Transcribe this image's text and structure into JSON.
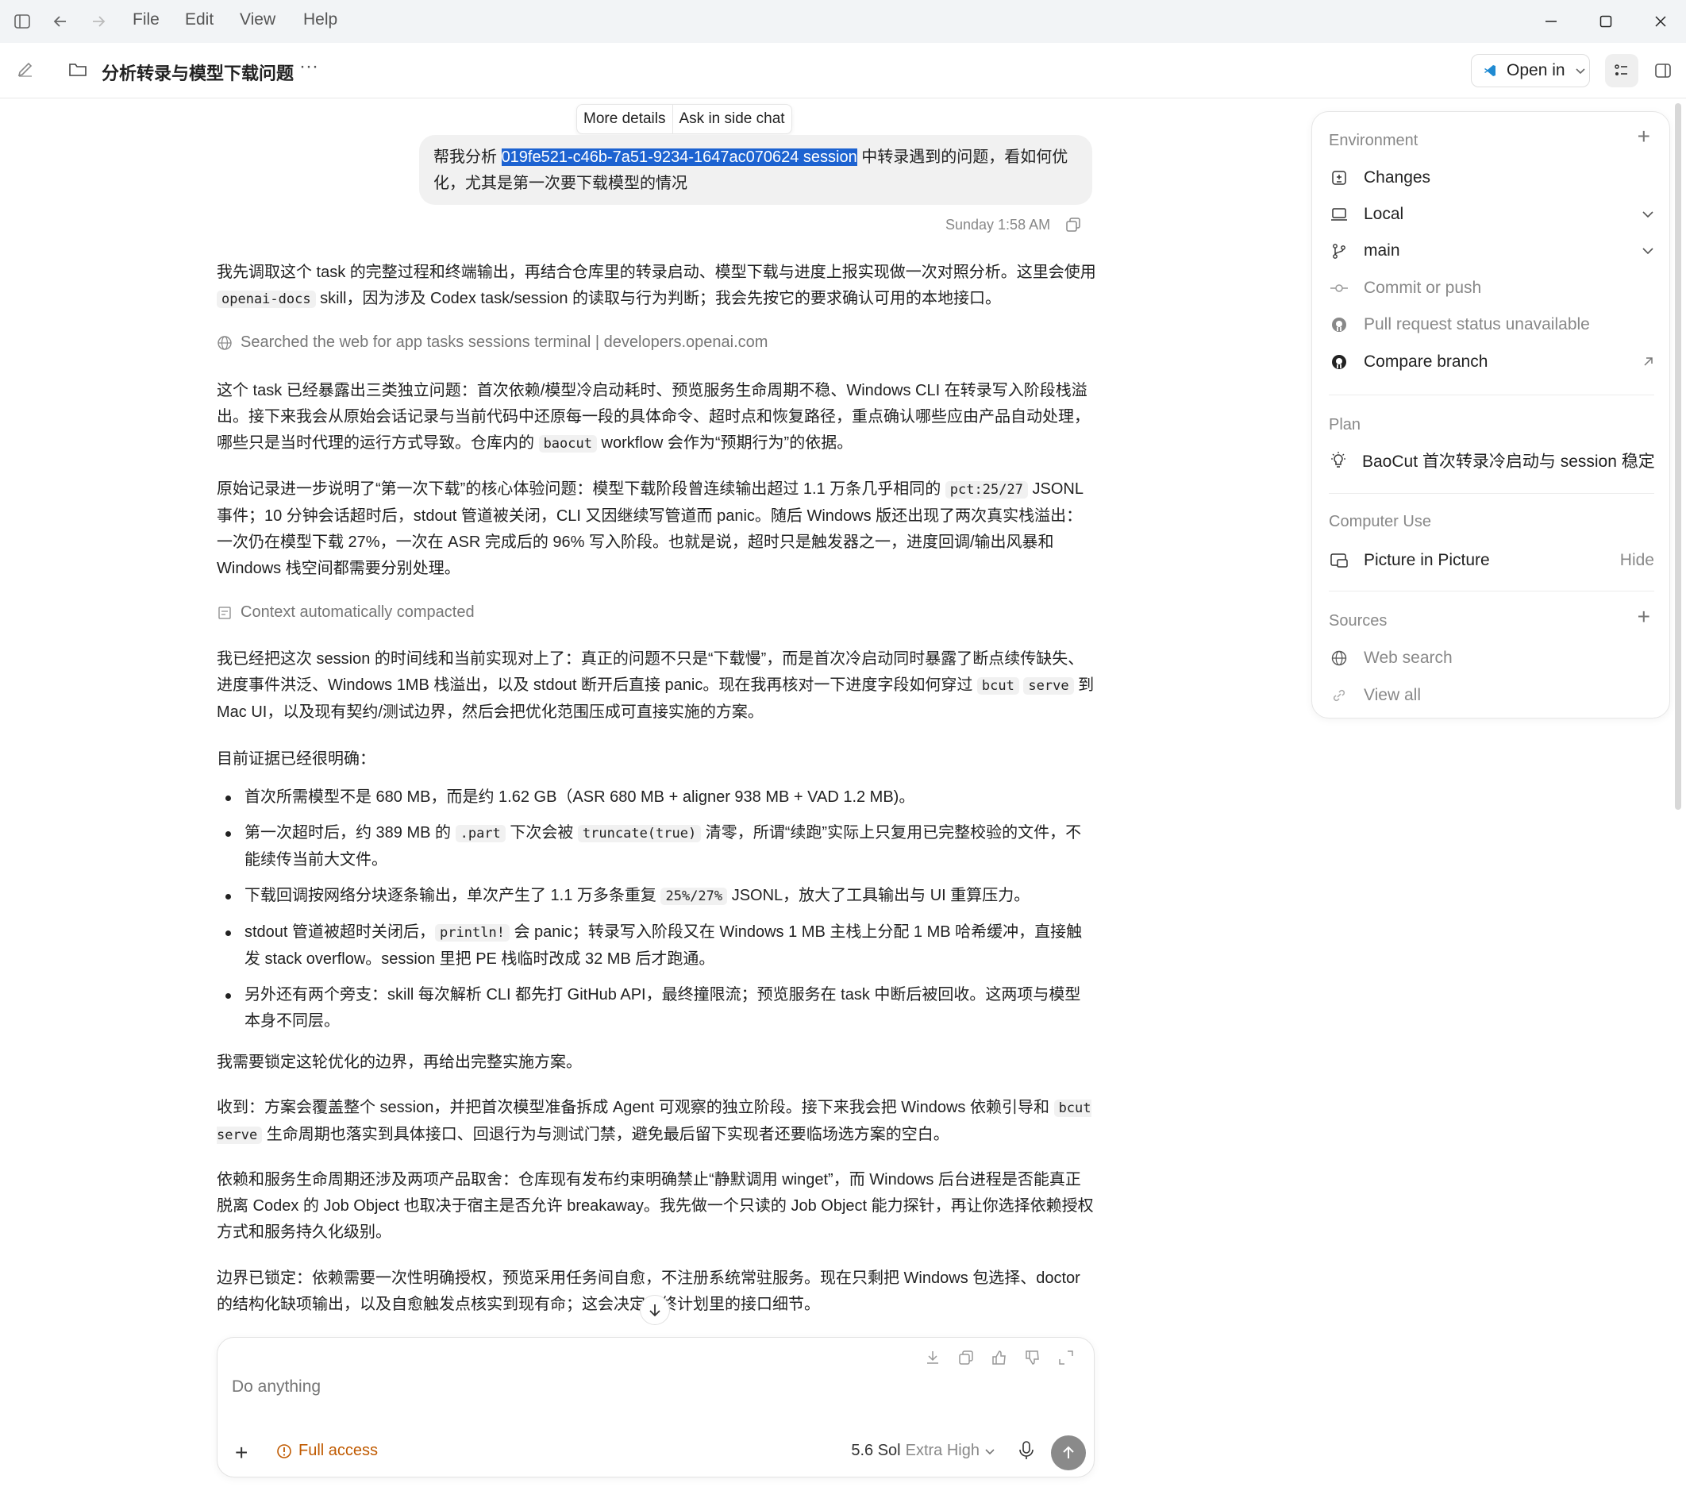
{
  "menu": {
    "file": "File",
    "edit": "Edit",
    "view": "View",
    "help": "Help"
  },
  "header": {
    "title": "分析转录与模型下载问题",
    "more": "···",
    "open_in": "Open in"
  },
  "tooltip": {
    "more_details": "More details",
    "ask_side": "Ask in side chat"
  },
  "user_message": {
    "prefix": "帮我分析 ",
    "highlight": "019fe521-c46b-7a51-9234-1647ac070624 session",
    "suffix": " 中转录遇到的问题，看如何优化，尤其是第一次要下载模型的情况",
    "timestamp": "Sunday 1:58 AM"
  },
  "messages": {
    "p1_a": "我先调取这个 task 的完整过程和终端输出，再结合仓库里的转录启动、模型下载与进度上报实现做一次对照分析。这里会使用 ",
    "p1_code": "openai-docs",
    "p1_b": " skill，因为涉及 Codex task/session 的读取与行为判断；我会先按它的要求确认可用的本地接口。",
    "search_status": "Searched the web for app tasks sessions terminal | developers.openai.com",
    "p2_a": "这个 task 已经暴露出三类独立问题：首次依赖/模型冷启动耗时、预览服务生命周期不稳、Windows CLI 在转录写入阶段栈溢出。接下来我会从原始会话记录与当前代码中还原每一段的具体命令、超时点和恢复路径，重点确认哪些应由产品自动处理，哪些只是当时代理的运行方式导致。仓库内的 ",
    "p2_code": "baocut",
    "p2_b": " workflow 会作为“预期行为”的依据。",
    "p3_a": "原始记录进一步说明了“第一次下载”的核心体验问题：模型下载阶段曾连续输出超过 1.1 万条几乎相同的 ",
    "p3_code": "pct:25/27",
    "p3_b": " JSONL 事件；10 分钟会话超时后，stdout 管道被关闭，CLI 又因继续写管道而 panic。随后 Windows 版还出现了两次真实栈溢出：一次仍在模型下载 27%，一次在 ASR 完成后的 96% 写入阶段。也就是说，超时只是触发器之一，进度回调/输出风暴和 Windows 栈空间都需要分别处理。",
    "compact_status": "Context automatically compacted",
    "p4_a": "我已经把这次 session 的时间线和当前实现对上了：真正的问题不只是“下载慢”，而是首次冷启动同时暴露了断点续传缺失、进度事件洪泛、Windows 1MB 栈溢出，以及 stdout 断开后直接 panic。现在我再核对一下进度字段如何穿过 ",
    "p4_code1": "bcut",
    "p4_code2": "serve",
    "p4_b": " 到 Mac UI，以及现有契约/测试边界，然后会把优化范围压成可直接实施的方案。",
    "p5": "目前证据已经很明确：",
    "b1": "首次所需模型不是 680 MB，而是约 1.62 GB（ASR 680 MB + aligner 938 MB + VAD 1.2 MB)。",
    "b2_a": "第一次超时后，约 389 MB 的 ",
    "b2_code1": ".part",
    "b2_b": " 下次会被 ",
    "b2_code2": "truncate(true)",
    "b2_c": " 清零，所谓“续跑”实际上只复用已完整校验的文件，不能续传当前大文件。",
    "b3_a": "下载回调按网络分块逐条输出，单次产生了 1.1 万多条重复 ",
    "b3_code": "25%/27%",
    "b3_b": " JSONL，放大了工具输出与 UI 重算压力。",
    "b4_a": "stdout 管道被超时关闭后，",
    "b4_code": "println!",
    "b4_b": " 会 panic；转录写入阶段又在 Windows 1 MB 主栈上分配 1 MB 哈希缓冲，直接触发 stack overflow。session 里把 PE 栈临时改成 32 MB 后才跑通。",
    "b5": "另外还有两个旁支：skill 每次解析 CLI 都先打 GitHub API，最终撞限流；预览服务在 task 中断后被回收。这两项与模型本身不同层。",
    "p6": "我需要锁定这轮优化的边界，再给出完整实施方案。",
    "p7_a": "收到：方案会覆盖整个 session，并把首次模型准备拆成 Agent 可观察的独立阶段。接下来我会把 Windows 依赖引导和 ",
    "p7_code": "bcut serve",
    "p7_b": " 生命周期也落实到具体接口、回退行为与测试门禁，避免最后留下实现者还要临场选方案的空白。",
    "p8": "依赖和服务生命周期还涉及两项产品取舍：仓库现有发布约束明确禁止“静默调用 winget”，而 Windows 后台进程是否能真正脱离 Codex 的 Job Object 也取决于宿主是否允许 breakaway。我先做一个只读的 Job Object 能力探针，再让你选择依赖授权方式和服务持久化级别。",
    "p9_a": "边界已锁定：依赖需要一次性明确授权，预览采用任务间自愈，不注册系统常驻服务。现在只剩把 Windows 包选择、doctor 的结构化缺项输出，以及自愈触发点核实到现有命",
    "p9_b": "；这会决定最终计划里的接口细节。"
  },
  "composer": {
    "placeholder": "Do anything",
    "access": "Full access",
    "model": "5.6 Sol",
    "effort": "Extra High"
  },
  "side_panel": {
    "environment": "Environment",
    "changes": "Changes",
    "local": "Local",
    "branch": "main",
    "commit": "Commit or push",
    "pr_status": "Pull request status unavailable",
    "compare": "Compare branch",
    "plan": "Plan",
    "plan_item": "BaoCut 首次转录冷启动与 session 稳定",
    "computer_use": "Computer Use",
    "pip": "Picture in Picture",
    "hide": "Hide",
    "sources": "Sources",
    "web_search": "Web search",
    "view_all": "View all"
  }
}
